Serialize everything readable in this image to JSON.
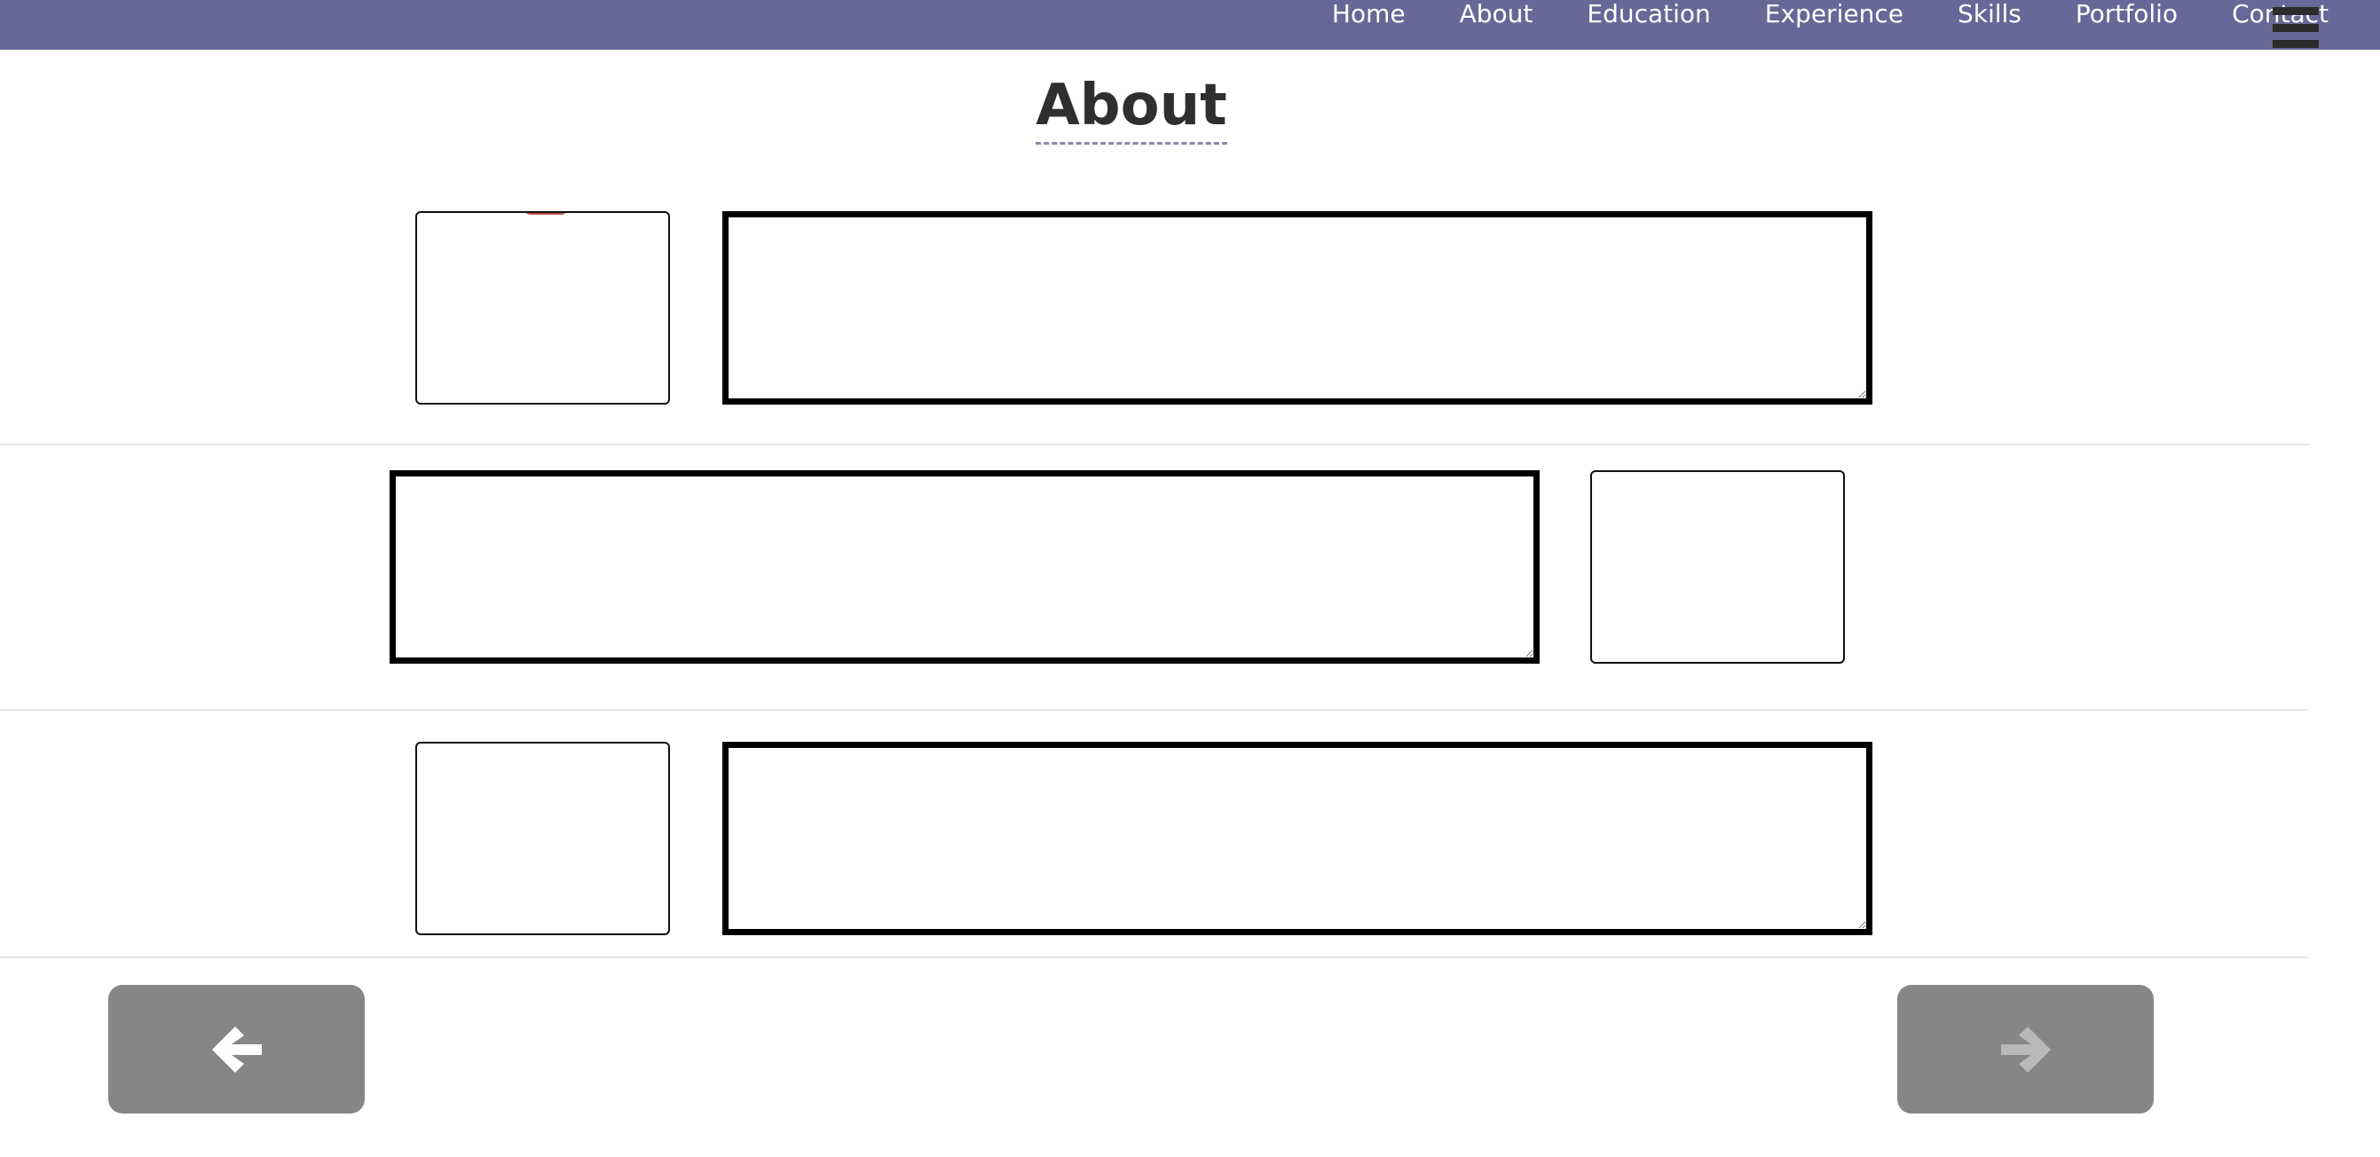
{
  "nav": {
    "links": [
      "Home",
      "About",
      "Education",
      "Experience",
      "Skills",
      "Portfolio",
      "Contact"
    ],
    "menu_icon": "hamburger-menu-icon"
  },
  "section": {
    "title": "About"
  },
  "entries": [
    {
      "photo_icon": "image-placeholder",
      "text_value": ""
    },
    {
      "photo_icon": "image-placeholder",
      "text_value": ""
    },
    {
      "photo_icon": "image-placeholder",
      "text_value": ""
    }
  ],
  "pager": {
    "prev_icon": "arrow-left-icon",
    "next_icon": "arrow-right-icon"
  },
  "colors": {
    "navbar": "#676897",
    "nav_text": "#ffffff",
    "pager_button": "#868686",
    "text_box_border": "#000000"
  }
}
